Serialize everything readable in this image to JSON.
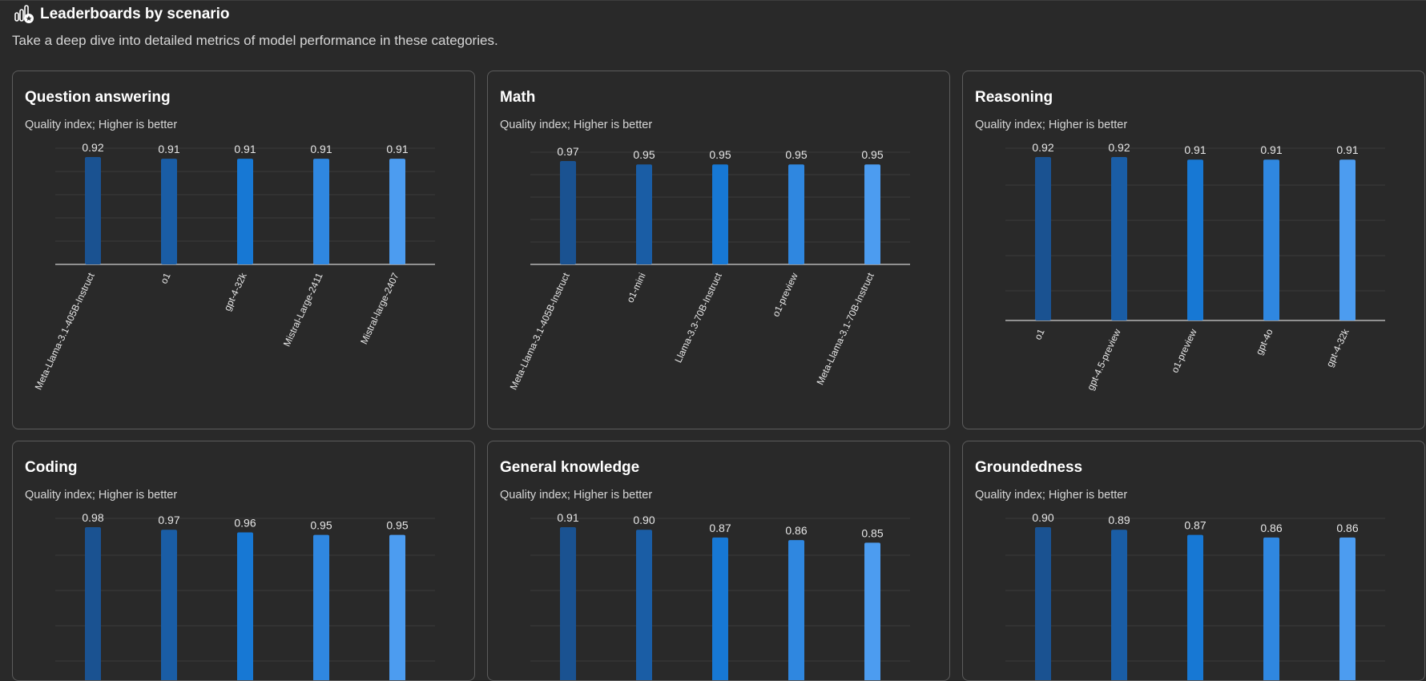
{
  "header": {
    "title": "Leaderboards by scenario",
    "subtitle": "Take a deep dive into detailed metrics of model performance in these categories."
  },
  "colors": [
    "#1a5291",
    "#1a5da5",
    "#1778d4",
    "#2f87e0",
    "#4c9cf0"
  ],
  "chart_data": [
    {
      "type": "bar",
      "title": "Question answering",
      "subtitle": "Quality index; Higher is better",
      "categories": [
        "Meta-Llama-3.1-405B-Instruct",
        "o1",
        "gpt-4-32k",
        "Mistral-Large-2411",
        "Mistral-large-2407"
      ],
      "values": [
        0.92,
        0.91,
        0.91,
        0.91,
        0.91
      ]
    },
    {
      "type": "bar",
      "title": "Math",
      "subtitle": "Quality index; Higher is better",
      "categories": [
        "Meta-Llama-3.1-405B-Instruct",
        "o1-mini",
        "Llama-3.3-70B-Instruct",
        "o1-preview",
        "Meta-Llama-3.1-70B-Instruct"
      ],
      "values": [
        0.97,
        0.95,
        0.95,
        0.95,
        0.95
      ]
    },
    {
      "type": "bar",
      "title": "Reasoning",
      "subtitle": "Quality index; Higher is better",
      "categories": [
        "o1",
        "gpt-4.5-preview",
        "o1-preview",
        "gpt-4o",
        "gpt-4-32k"
      ],
      "values": [
        0.92,
        0.92,
        0.91,
        0.91,
        0.91
      ]
    },
    {
      "type": "bar",
      "title": "Coding",
      "subtitle": "Quality index; Higher is better",
      "categories": [
        "",
        "",
        "",
        "",
        ""
      ],
      "values": [
        0.98,
        0.97,
        0.96,
        0.95,
        0.95
      ]
    },
    {
      "type": "bar",
      "title": "General knowledge",
      "subtitle": "Quality index; Higher is better",
      "categories": [
        "",
        "",
        "",
        "",
        ""
      ],
      "values": [
        0.91,
        0.9,
        0.87,
        0.86,
        0.85
      ]
    },
    {
      "type": "bar",
      "title": "Groundedness",
      "subtitle": "Quality index; Higher is better",
      "categories": [
        "",
        "",
        "",
        "",
        ""
      ],
      "values": [
        0.9,
        0.89,
        0.87,
        0.86,
        0.86
      ]
    }
  ]
}
